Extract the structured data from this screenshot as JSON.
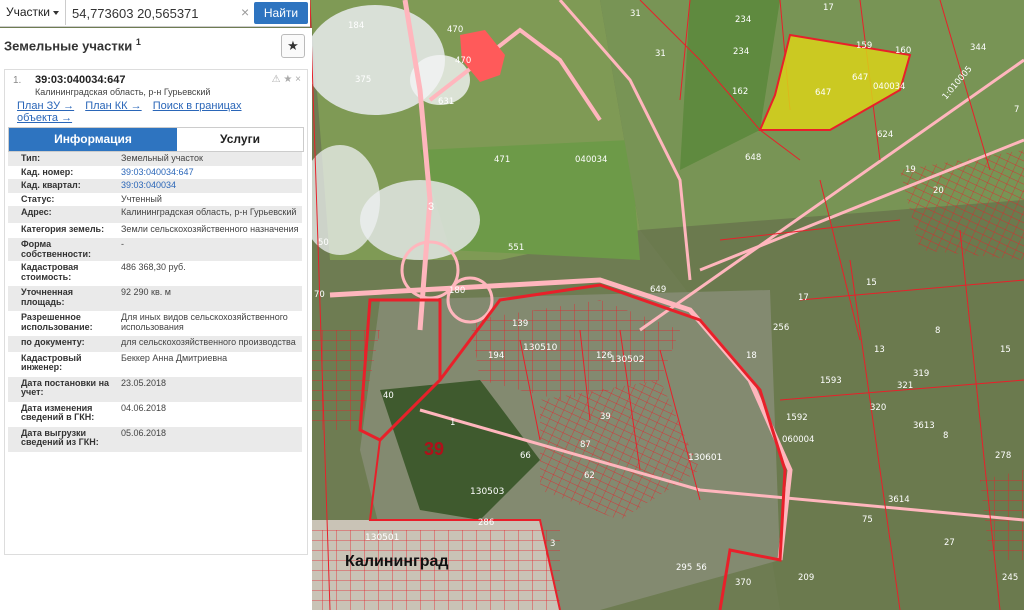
{
  "search": {
    "category": "Участки",
    "query": "54,773603 20,565371",
    "button": "Найти"
  },
  "panel": {
    "title": "Земельные участки",
    "title_sup": "1",
    "card": {
      "index": "1.",
      "cadastral_number": "39:03:040034:647",
      "address": "Калининградская область, р-н Гурьевский",
      "links": [
        "План ЗУ →",
        "План КК →",
        "Поиск в границах объекта →"
      ],
      "tabs": [
        "Информация",
        "Услуги"
      ],
      "rows": [
        {
          "k": "Тип:",
          "v": "Земельный участок"
        },
        {
          "k": "Кад. номер:",
          "v": "39:03:040034:647"
        },
        {
          "k": "Кад. квартал:",
          "v": "39:03:040034"
        },
        {
          "k": "Статус:",
          "v": "Учтенный"
        },
        {
          "k": "Адрес:",
          "v": "Калининградская область, р-н Гурьевский"
        },
        {
          "k": "Категория земель:",
          "v": "Земли сельскохозяйственного назначения"
        },
        {
          "k": "Форма собственности:",
          "v": "-"
        },
        {
          "k": "Кадастровая стоимость:",
          "v": "486 368,30 руб."
        },
        {
          "k": "Уточненная площадь:",
          "v": "92 290 кв. м"
        },
        {
          "k": "Разрешенное использование:",
          "v": "Для иных видов сельскохозяйственного использования"
        },
        {
          "k": "по документу:",
          "v": "для сельскохозяйственного производства"
        },
        {
          "k": "Кадастровый инженер:",
          "v": "Беккер Анна Дмитриевна"
        },
        {
          "k": "Дата постановки на учет:",
          "v": "23.05.2018"
        },
        {
          "k": "Дата изменения сведений в ГКН:",
          "v": "04.06.2018"
        },
        {
          "k": "Дата выгрузки сведений из ГКН:",
          "v": "05.06.2018"
        }
      ]
    }
  },
  "map": {
    "city": "Калининград",
    "district": "39",
    "road": "3",
    "parcel_labels": [
      "184",
      "470",
      "375",
      "631",
      "470",
      "471",
      "040034",
      "551",
      "180",
      "50",
      "70",
      "649",
      "31",
      "234",
      "31",
      "17",
      "234",
      "162",
      "159",
      "160",
      "647",
      "647",
      "040034",
      "624",
      "648",
      "344",
      "1:010005",
      "7",
      "19",
      "20",
      "130510",
      "130502",
      "126",
      "194",
      "139",
      "40",
      "18",
      "256",
      "15",
      "17",
      "8",
      "13",
      "15",
      "1593",
      "321",
      "319",
      "320",
      "3613",
      "1592",
      "060004",
      "1",
      "130601",
      "8",
      "278",
      "66",
      "87",
      "62",
      "39",
      "130503",
      "286",
      "3614",
      "130501",
      "3",
      "75",
      "245",
      "295",
      "56",
      "27",
      "370",
      "209"
    ]
  },
  "colors": {
    "accent": "#2e74c0",
    "selected_parcel": "#d9d21a",
    "parcel_border": "#e8202a",
    "kvartal_border": "#ff9aa2"
  }
}
